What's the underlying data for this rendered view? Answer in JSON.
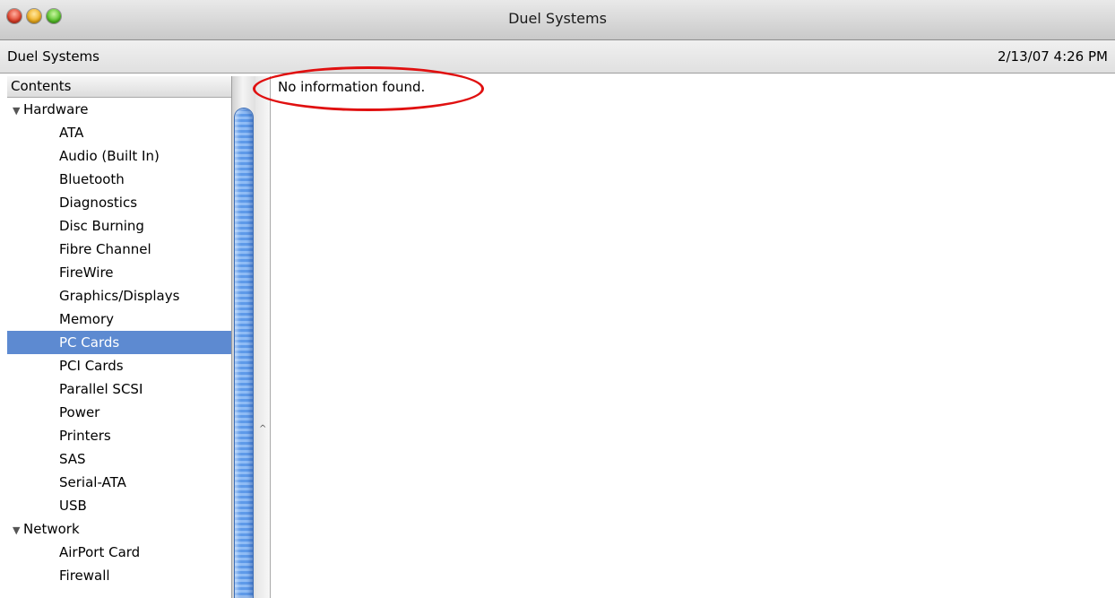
{
  "window": {
    "title": "Duel Systems",
    "controls": [
      "close-button",
      "minimize-button",
      "zoom-button"
    ]
  },
  "toolbar": {
    "machine_name": "Duel Systems",
    "timestamp": "2/13/07 4:26 PM"
  },
  "sidebar": {
    "header": "Contents",
    "groups": [
      {
        "label": "Hardware",
        "expanded": true,
        "items": [
          {
            "label": "ATA"
          },
          {
            "label": "Audio (Built In)"
          },
          {
            "label": "Bluetooth"
          },
          {
            "label": "Diagnostics"
          },
          {
            "label": "Disc Burning"
          },
          {
            "label": "Fibre Channel"
          },
          {
            "label": "FireWire"
          },
          {
            "label": "Graphics/Displays"
          },
          {
            "label": "Memory"
          },
          {
            "label": "PC Cards",
            "selected": true
          },
          {
            "label": "PCI Cards"
          },
          {
            "label": "Parallel SCSI"
          },
          {
            "label": "Power"
          },
          {
            "label": "Printers"
          },
          {
            "label": "SAS"
          },
          {
            "label": "Serial-ATA"
          },
          {
            "label": "USB"
          }
        ]
      },
      {
        "label": "Network",
        "expanded": true,
        "items": [
          {
            "label": "AirPort Card"
          },
          {
            "label": "Firewall"
          }
        ]
      }
    ]
  },
  "content": {
    "message": "No information found."
  },
  "colors": {
    "selection": "#5d8ad1",
    "annotation": "#e01010",
    "scrollbar": "#5e9ae9"
  }
}
